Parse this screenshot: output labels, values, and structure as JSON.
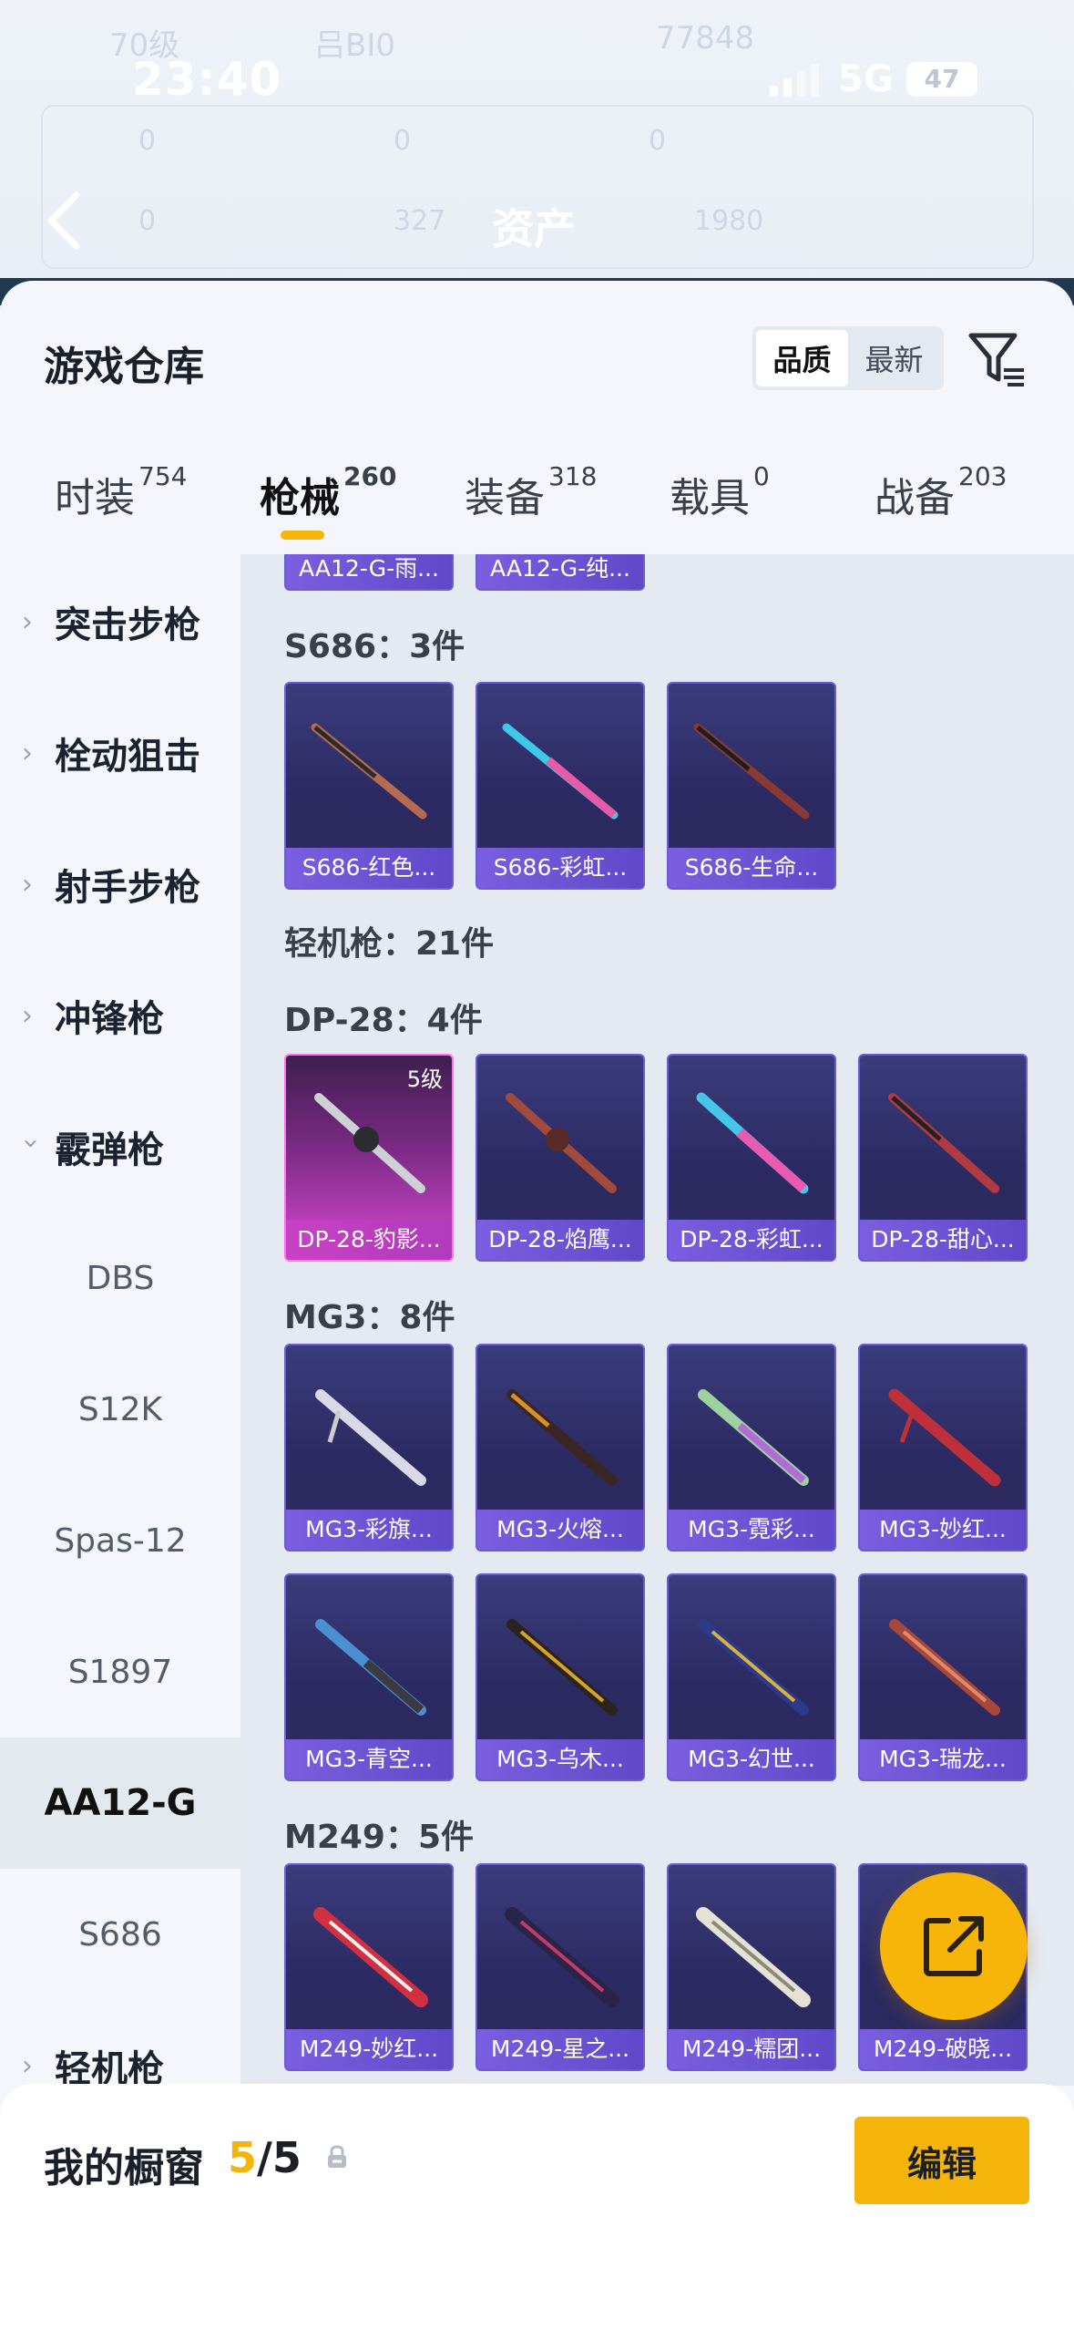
{
  "status": {
    "time": "23:40",
    "network": "5G",
    "battery": "47"
  },
  "header": {
    "title": "资产"
  },
  "ghost": {
    "level": "70级",
    "id_text": "吕BI0",
    "score": "77848",
    "count_a": "0",
    "count_b": "0",
    "count_c": "0",
    "count_d": "0",
    "count_e": "327",
    "count_f": "1980"
  },
  "warehouse": {
    "title": "游戏仓库",
    "sort_options": [
      "品质",
      "最新"
    ],
    "sort_selected": "品质"
  },
  "tabs": [
    {
      "label": "时装",
      "count": "754"
    },
    {
      "label": "枪械",
      "count": "260"
    },
    {
      "label": "装备",
      "count": "318"
    },
    {
      "label": "载具",
      "count": "0"
    },
    {
      "label": "战备",
      "count": "203"
    }
  ],
  "sidebar": {
    "items": [
      {
        "label": "突击步枪"
      },
      {
        "label": "栓动狙击"
      },
      {
        "label": "射手步枪"
      },
      {
        "label": "冲锋枪"
      },
      {
        "label": "霰弹枪"
      }
    ],
    "subitems": [
      "DBS",
      "S12K",
      "Spas-12",
      "S1897",
      "AA12-G",
      "S686"
    ],
    "last_item": "轻机枪"
  },
  "content": {
    "top_cards": [
      "AA12-G-雨...",
      "AA12-G-纯..."
    ],
    "s686": {
      "heading": "S686：3件",
      "cards": [
        "S686-红色...",
        "S686-彩虹...",
        "S686-生命..."
      ]
    },
    "lmg_heading": "轻机枪：21件",
    "dp28": {
      "heading": "DP-28：4件",
      "level_badge": "5级",
      "cards": [
        "DP-28-豹影...",
        "DP-28-焰鹰...",
        "DP-28-彩虹...",
        "DP-28-甜心..."
      ]
    },
    "mg3": {
      "heading": "MG3：8件",
      "cards": [
        "MG3-彩旗...",
        "MG3-火熔...",
        "MG3-霓彩...",
        "MG3-妙红...",
        "MG3-青空...",
        "MG3-乌木...",
        "MG3-幻世...",
        "MG3-瑞龙..."
      ]
    },
    "m249": {
      "heading": "M249：5件",
      "cards": [
        "M249-妙红...",
        "M249-星之...",
        "M249-糯团...",
        "M249-破晓..."
      ]
    }
  },
  "showcase": {
    "title": "我的橱窗",
    "current": "5",
    "total": "/5",
    "edit_label": "编辑"
  },
  "colors": {
    "accent": "#f5b40a",
    "card_purple": "#2c2a62",
    "card_pink": "#d84ad2"
  }
}
